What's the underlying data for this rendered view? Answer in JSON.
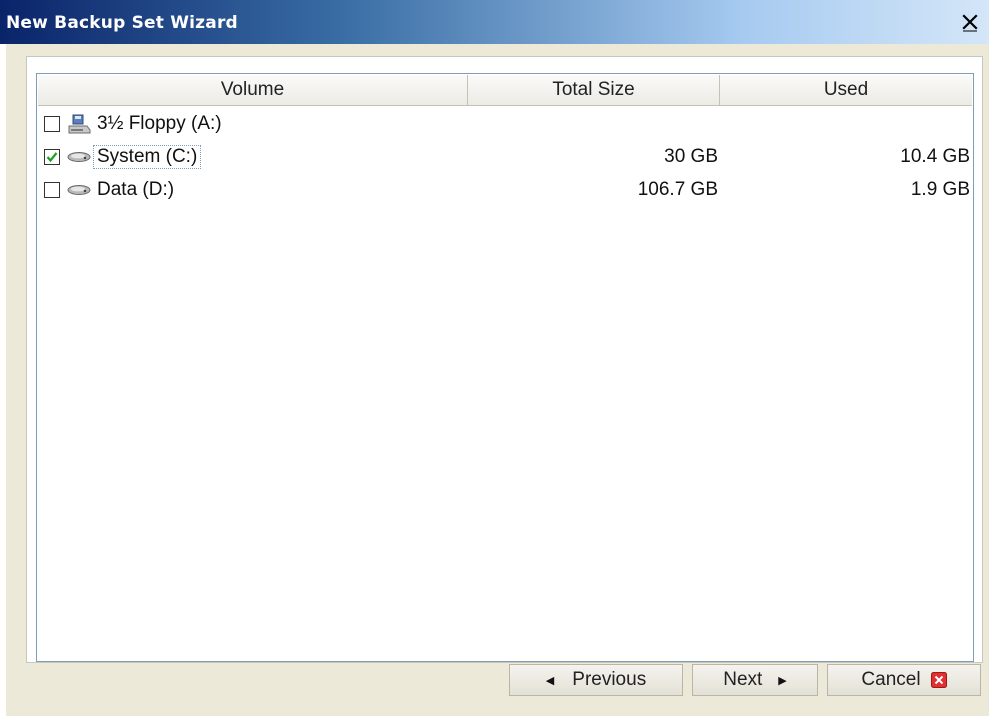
{
  "window": {
    "title": "New Backup Set Wizard"
  },
  "table": {
    "columns": [
      "Volume",
      "Total Size",
      "Used"
    ],
    "rows": [
      {
        "checked": false,
        "icon": "floppy-drive-icon",
        "name": "3½ Floppy (A:)",
        "total": "",
        "used": ""
      },
      {
        "checked": true,
        "icon": "hard-drive-icon",
        "name": "System (C:)",
        "total": "30 GB",
        "used": "10.4 GB"
      },
      {
        "checked": false,
        "icon": "hard-drive-icon",
        "name": "Data (D:)",
        "total": "106.7 GB",
        "used": "1.9 GB"
      }
    ]
  },
  "buttons": {
    "previous": "Previous",
    "next": "Next",
    "cancel": "Cancel"
  },
  "colors": {
    "titlebar_start": "#0a246a",
    "titlebar_end": "#d4e6f8",
    "dialog_bg": "#ece9d8",
    "check_green": "#21a121",
    "cancel_red": "#e03030"
  }
}
